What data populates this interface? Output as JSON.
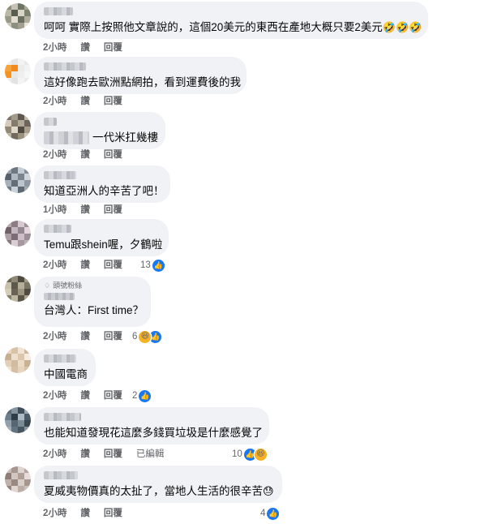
{
  "comments": [
    {
      "text": "呵呵 實際上按照他文章說的，這個20美元的東西在產地大概只要2美元",
      "emoji": "🤣🤣🤣",
      "time": "2小時",
      "like": "讚",
      "reply": "回覆"
    },
    {
      "text": "這好像跑去歐洲點網拍，看到運費後的我",
      "time": "2小時",
      "like": "讚",
      "reply": "回覆"
    },
    {
      "text": "一代米扛幾樓",
      "time": "2小時",
      "like": "讚",
      "reply": "回覆"
    },
    {
      "text": "知道亞洲人的辛苦了吧！",
      "time": "1小時",
      "like": "讚",
      "reply": "回覆"
    },
    {
      "text": "Temu跟shein喔，夕鶴啦",
      "time": "2小時",
      "like": "讚",
      "reply": "回覆",
      "reaction_count": "13"
    },
    {
      "badge": "頭號粉絲",
      "text": "台灣人：First time？",
      "time": "2小時",
      "like": "讚",
      "reply": "回覆",
      "reaction_count": "6"
    },
    {
      "text": "中國電商",
      "time": "2小時",
      "like": "讚",
      "reply": "回覆",
      "reaction_count": "2"
    },
    {
      "text": "也能知道發現花這麼多錢買垃圾是什麼感覺了",
      "time": "2小時",
      "like": "讚",
      "reply": "回覆",
      "edited": "已編輯",
      "reaction_count": "10"
    },
    {
      "text": "夏威夷物價真的太扯了，當地人生活的很辛苦",
      "emoji": "😓",
      "time": "2小時",
      "like": "讚",
      "reply": "回覆",
      "reaction_count": "4"
    }
  ],
  "colors": {
    "bubble": "#f0f2f5",
    "meta": "#65676b",
    "like": "#1877f2"
  },
  "icons": {
    "like": "like-icon",
    "haha": "haha-icon",
    "badge": "diamond-icon"
  }
}
